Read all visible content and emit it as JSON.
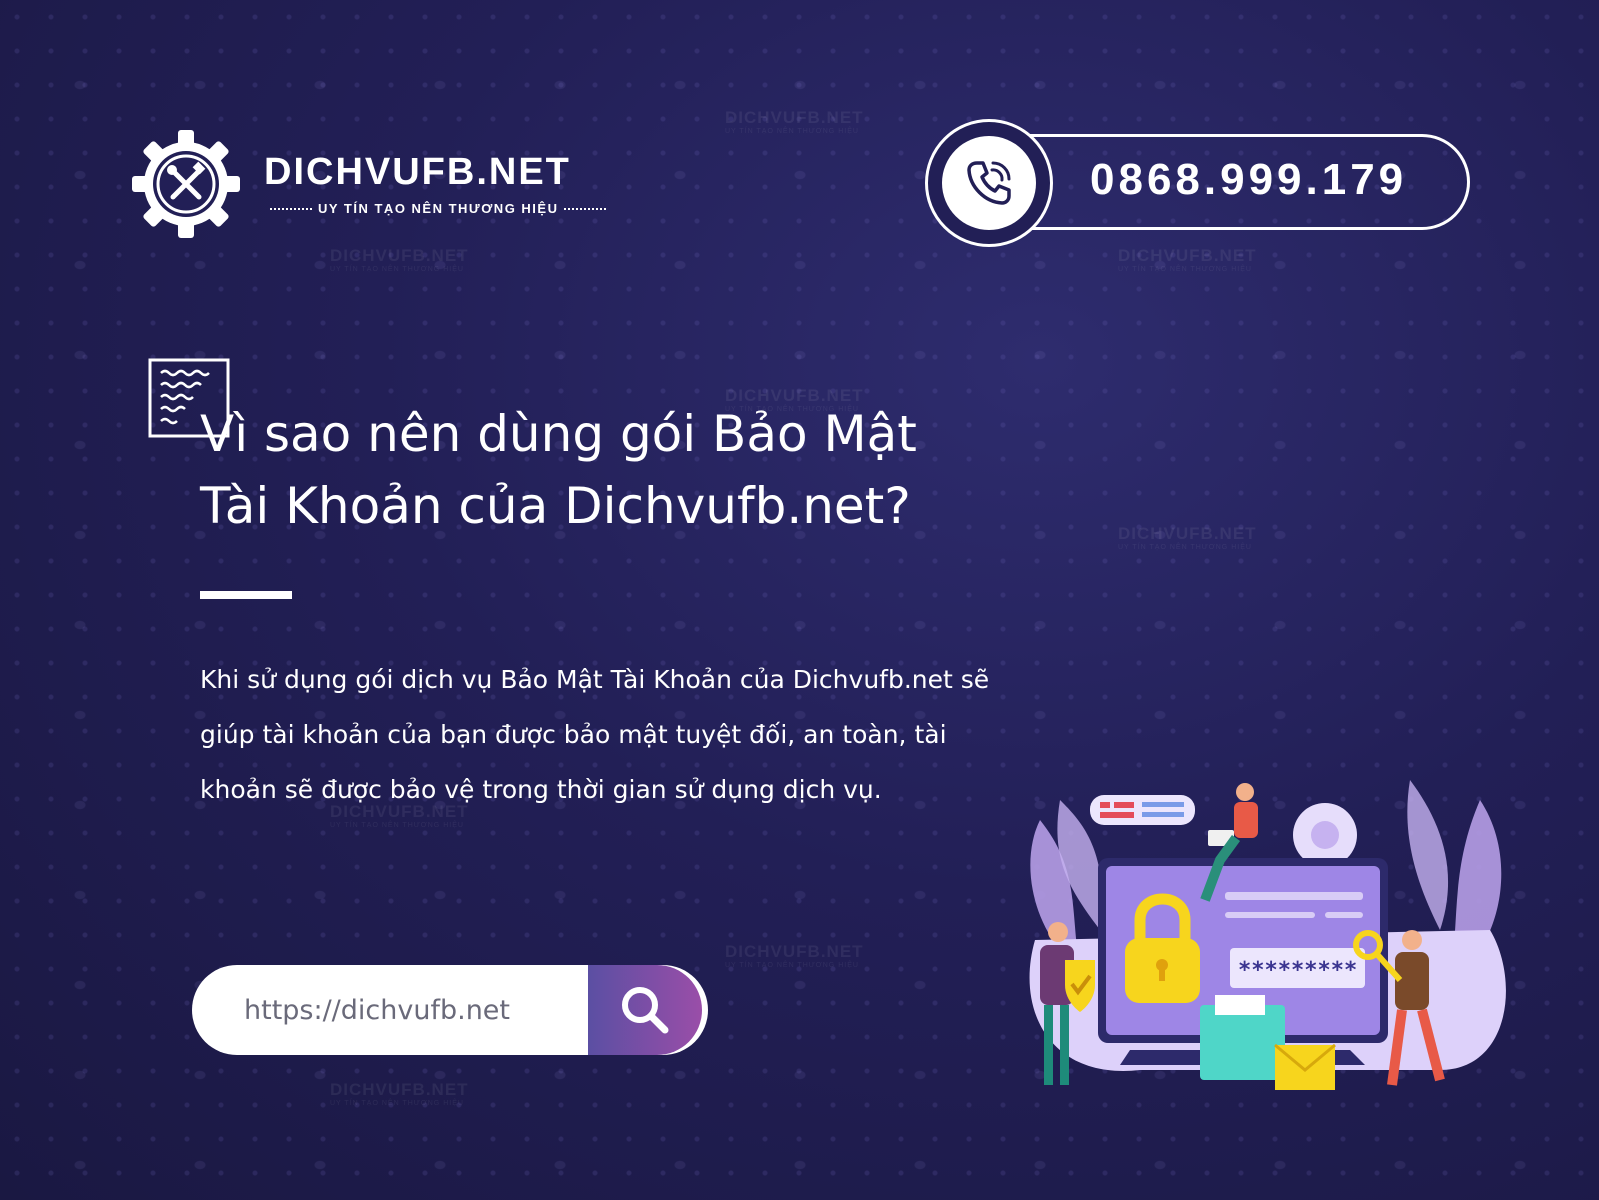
{
  "brand": {
    "name": "DICHVUFB.NET",
    "tagline": "UY TÍN TẠO NÊN THƯƠNG HIỆU"
  },
  "contact": {
    "phone": "0868.999.179"
  },
  "main": {
    "heading": "Vì sao nên dùng gói Bảo Mật Tài Khoản của Dichvufb.net?",
    "description": "Khi sử dụng gói dịch vụ Bảo Mật Tài Khoản của Dichvufb.net sẽ giúp tài khoản của bạn được bảo mật tuyệt đối, an toàn, tài khoản sẽ được bảo vệ trong thời gian sử dụng dịch vụ."
  },
  "search": {
    "value": "https://dichvufb.net"
  },
  "illustration": {
    "password_mask": "*********"
  },
  "colors": {
    "background": "#221f56",
    "accent_gradient_start": "#5b4fa3",
    "accent_gradient_end": "#9a4ea8",
    "text": "#ffffff"
  },
  "icons": {
    "logo": "gear-tools-icon",
    "phone": "phone-call-icon",
    "document": "document-icon",
    "search": "search-icon"
  }
}
